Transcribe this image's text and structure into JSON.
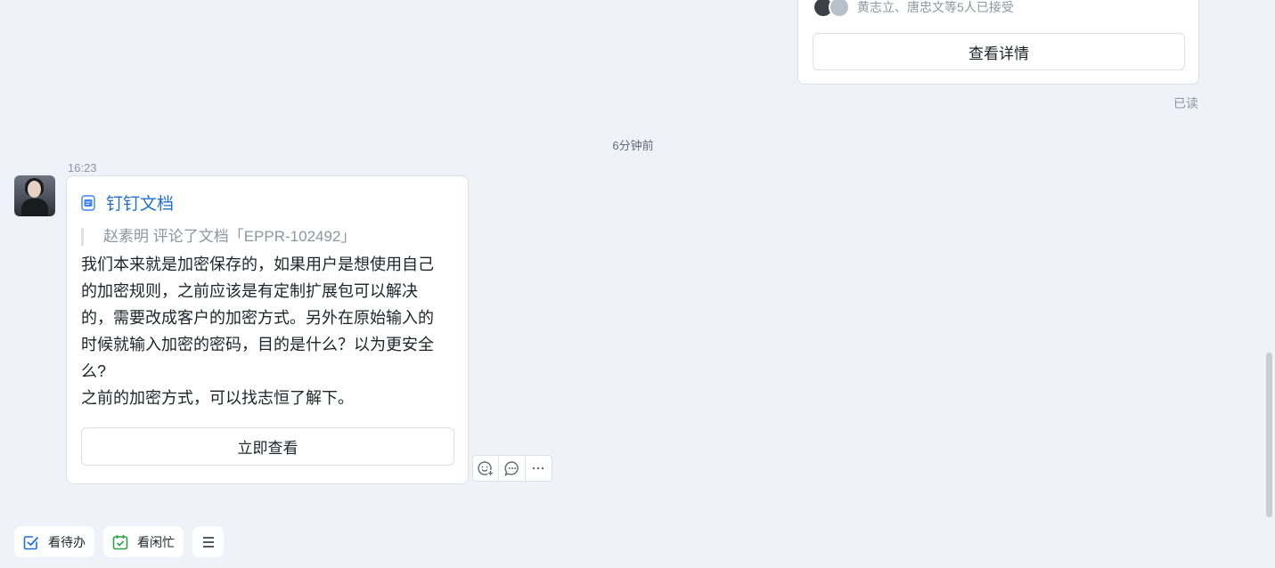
{
  "top_card": {
    "accept_text": "黄志立、唐忠文等5人已接受",
    "detail_button": "查看详情"
  },
  "read_status": "已读",
  "time_divider": "6分钟前",
  "message": {
    "time": "16:23",
    "doc_title": "钉钉文档",
    "quote": "赵素明 评论了文档「EPPR-102492」",
    "body_lines": [
      "我们本来就是加密保存的，如果用户是想使用自己",
      "的加密规则，之前应该是有定制扩展包可以解决",
      "的，需要改成客户的加密方式。另外在原始输入的",
      "时候就输入加密的密码，目的是什么？以为更安全",
      "么?",
      "之前的加密方式，可以找志恒了解下。"
    ],
    "view_button": "立即查看"
  },
  "hover_tools": [
    "emoji-reaction-icon",
    "reply-comment-icon",
    "more-icon"
  ],
  "bottom_bar": {
    "todo_label": "看待办",
    "busy_label": "看闲忙",
    "menu_icon": "menu-icon"
  },
  "colors": {
    "background": "#eff2f9",
    "link_blue": "#1f6fd6",
    "todo_icon": "#1f6fd6",
    "busy_icon": "#2ba245"
  }
}
